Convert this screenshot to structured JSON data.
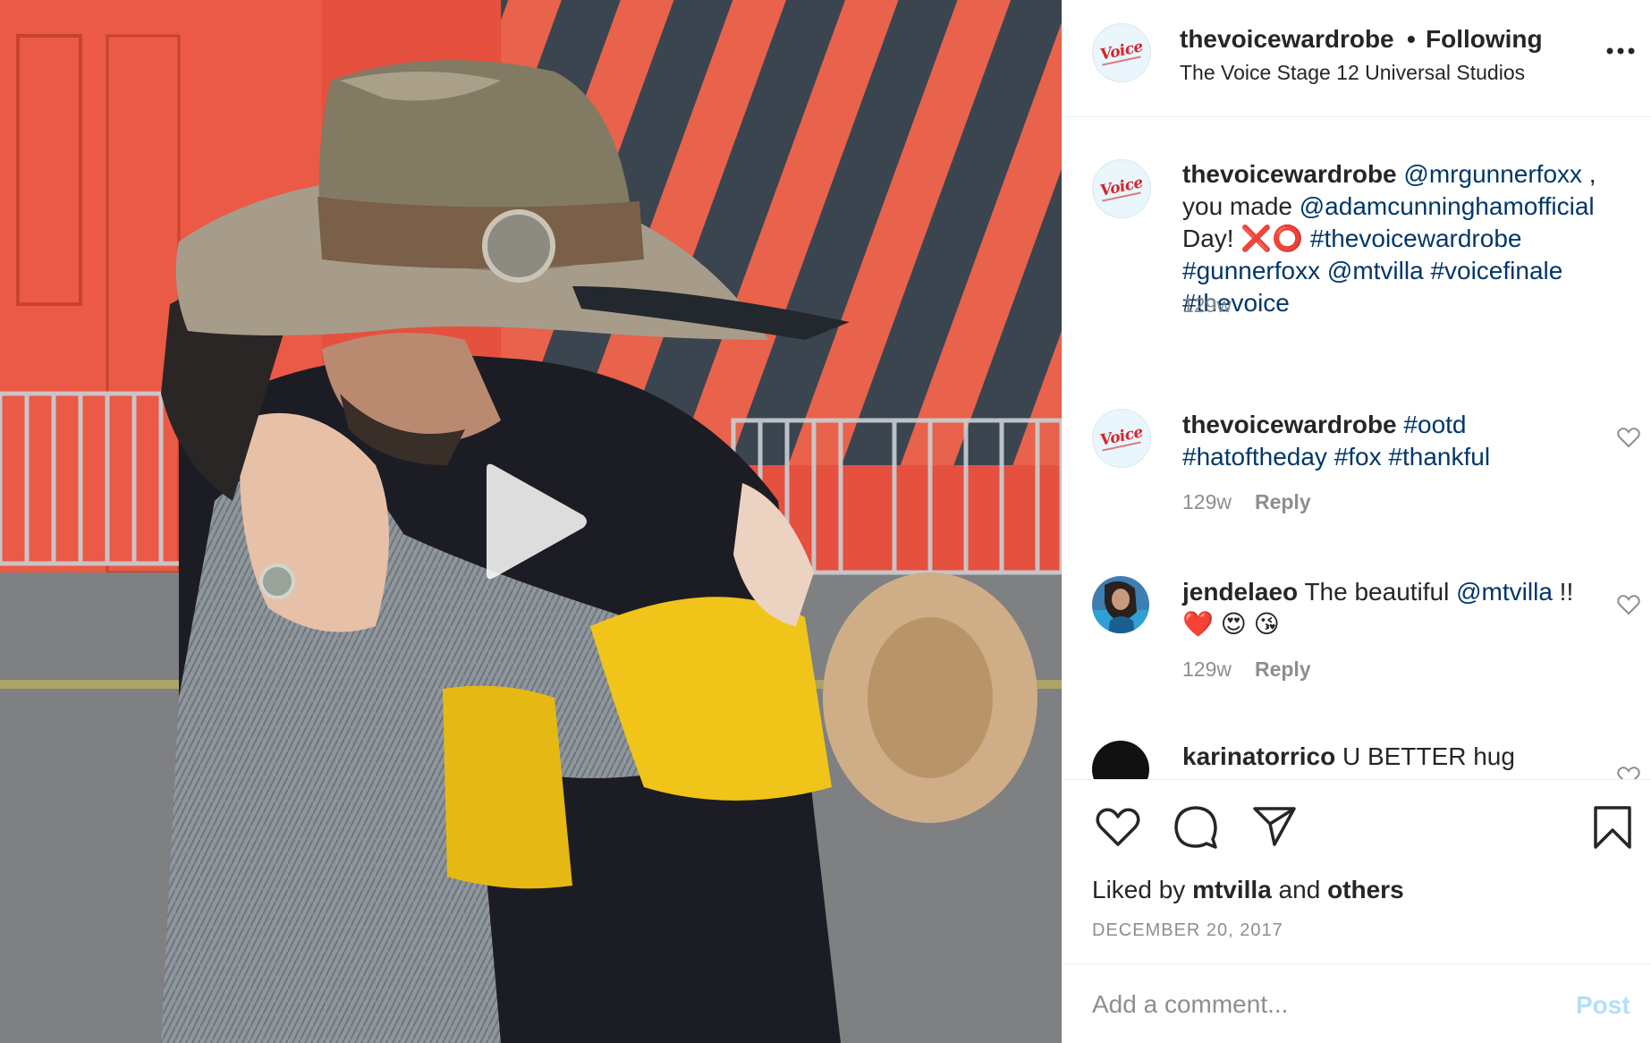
{
  "header": {
    "username": "thevoicewardrobe",
    "separator": "•",
    "follow_status": "Following",
    "location": "The Voice Stage 12 Universal Studios",
    "more_icon": "more-options-icon"
  },
  "avatar_logo_text": "Voice",
  "caption": {
    "username": "thevoicewardrobe",
    "mention1": "@mrgunnerfoxx",
    "text1": " ,",
    "text2": "you made ",
    "mention2": "@adamcunninghamofficial",
    "text3": "Day! ",
    "emoji": "❌⭕",
    "tag1": "#thevoicewardrobe",
    "tag2": "#gunnerfoxx",
    "mention3": "@mtvilla",
    "tag3": "#voicefinale",
    "tag4": "#thevoice",
    "time": "129w"
  },
  "comments": [
    {
      "username": "thevoicewardrobe",
      "tags": [
        "#ootd",
        "#hatoftheday",
        "#fox",
        "#thankful"
      ],
      "time": "129w",
      "reply": "Reply"
    },
    {
      "username": "jendelaeo",
      "text": "The beautiful ",
      "mention": "@mtvilla",
      "suffix": " !!",
      "emoji": "❤️ 😍 😘",
      "time": "129w",
      "reply": "Reply"
    },
    {
      "username": "karinatorrico",
      "text": "U BETTER hug"
    }
  ],
  "likes": {
    "prefix": "Liked by ",
    "user": "mtvilla",
    "and": " and ",
    "others": "others"
  },
  "date": "DECEMBER 20, 2017",
  "add_comment": {
    "placeholder": "Add a comment...",
    "post_label": "Post"
  },
  "colors": {
    "link": "#00376b",
    "muted": "#8e8e8e",
    "post_disabled": "#b2dffc",
    "brand_red": "#d6232a"
  }
}
